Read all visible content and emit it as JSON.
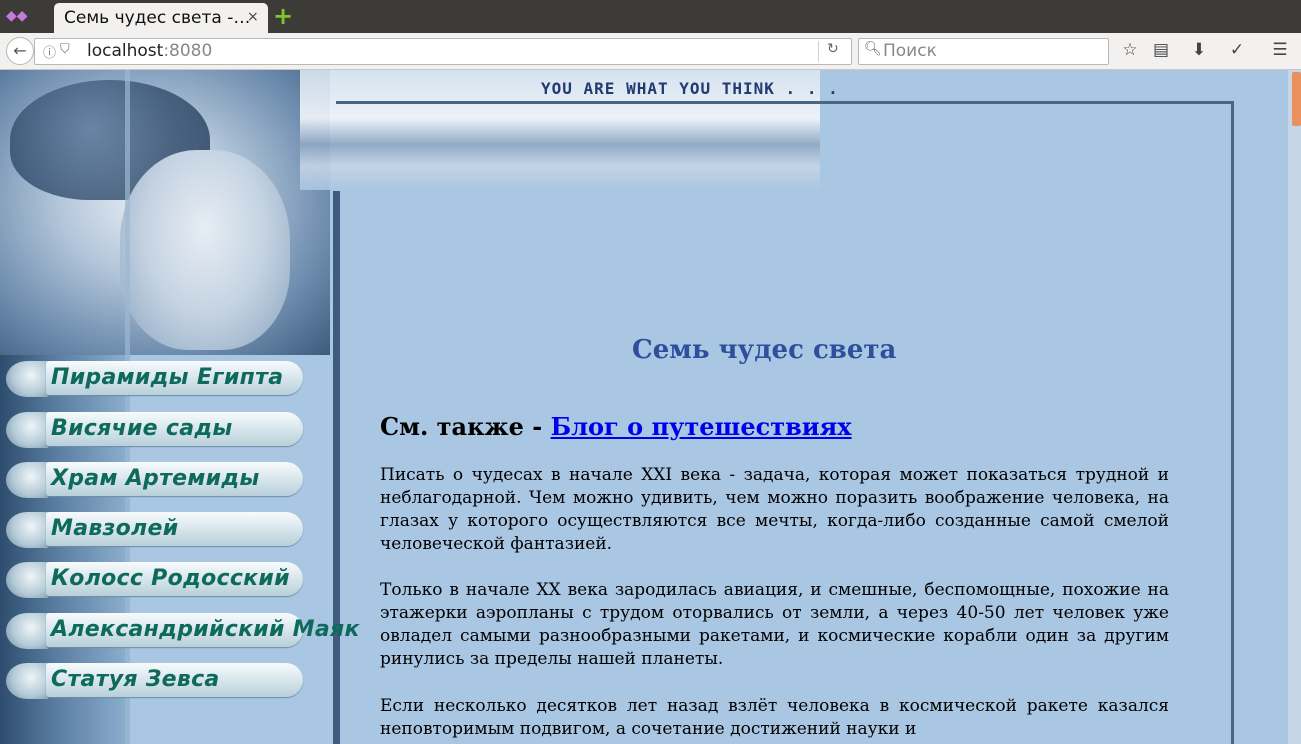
{
  "browser": {
    "tab_title": "Семь чудес света -…",
    "tab_close": "×",
    "new_tab": "+",
    "back": "←",
    "url_host": "localhost",
    "url_port": ":8080",
    "search_placeholder": "Поиск",
    "icons": [
      "back-icon",
      "info-icon",
      "shield-icon",
      "reload-icon",
      "search-icon",
      "bookmark-star-icon",
      "reading-list-icon",
      "download-icon",
      "pocket-icon",
      "menu-icon"
    ]
  },
  "site": {
    "banner_text": "YOU ARE WHAT YOU THINK . . .",
    "menu": [
      {
        "label": "Пирамиды Египта"
      },
      {
        "label": "Висячие сады"
      },
      {
        "label": "Храм Артемиды"
      },
      {
        "label": "Мавзолей"
      },
      {
        "label": "Колосс Родосский"
      },
      {
        "label": "Александрийский Маяк"
      },
      {
        "label": "Статуя Зевса"
      }
    ],
    "title": "Семь чудес света",
    "see_also_prefix": "См. также - ",
    "see_also_link": "Блог о путешествиях",
    "paragraphs": [
      "Писать о чудесах в начале XXI века - задача, которая может показаться трудной и неблагодарной. Чем можно удивить, чем можно поразить воображение человека, на глазах у которого осуществляются все мечты, когда-либо созданные самой смелой человеческой фантазией.",
      "Только в начале XX века зародилась авиация, и смешные, беспомощные, похожие на этажерки аэропланы с трудом оторвались от земли, а через 40-50 лет человек уже овладел самыми разнообразными ракетами, и космические корабли один за другим ринулись за пределы нашей планеты.",
      "Если несколько десятков лет назад взлёт человека в космической ракете казался неповторимым подвигом, а сочетание достижений науки и"
    ]
  },
  "colors": {
    "page_bg": "#a9c6e2",
    "menu_text": "#0e6b5c",
    "title": "#2d4f9c",
    "link": "#0000ee"
  }
}
